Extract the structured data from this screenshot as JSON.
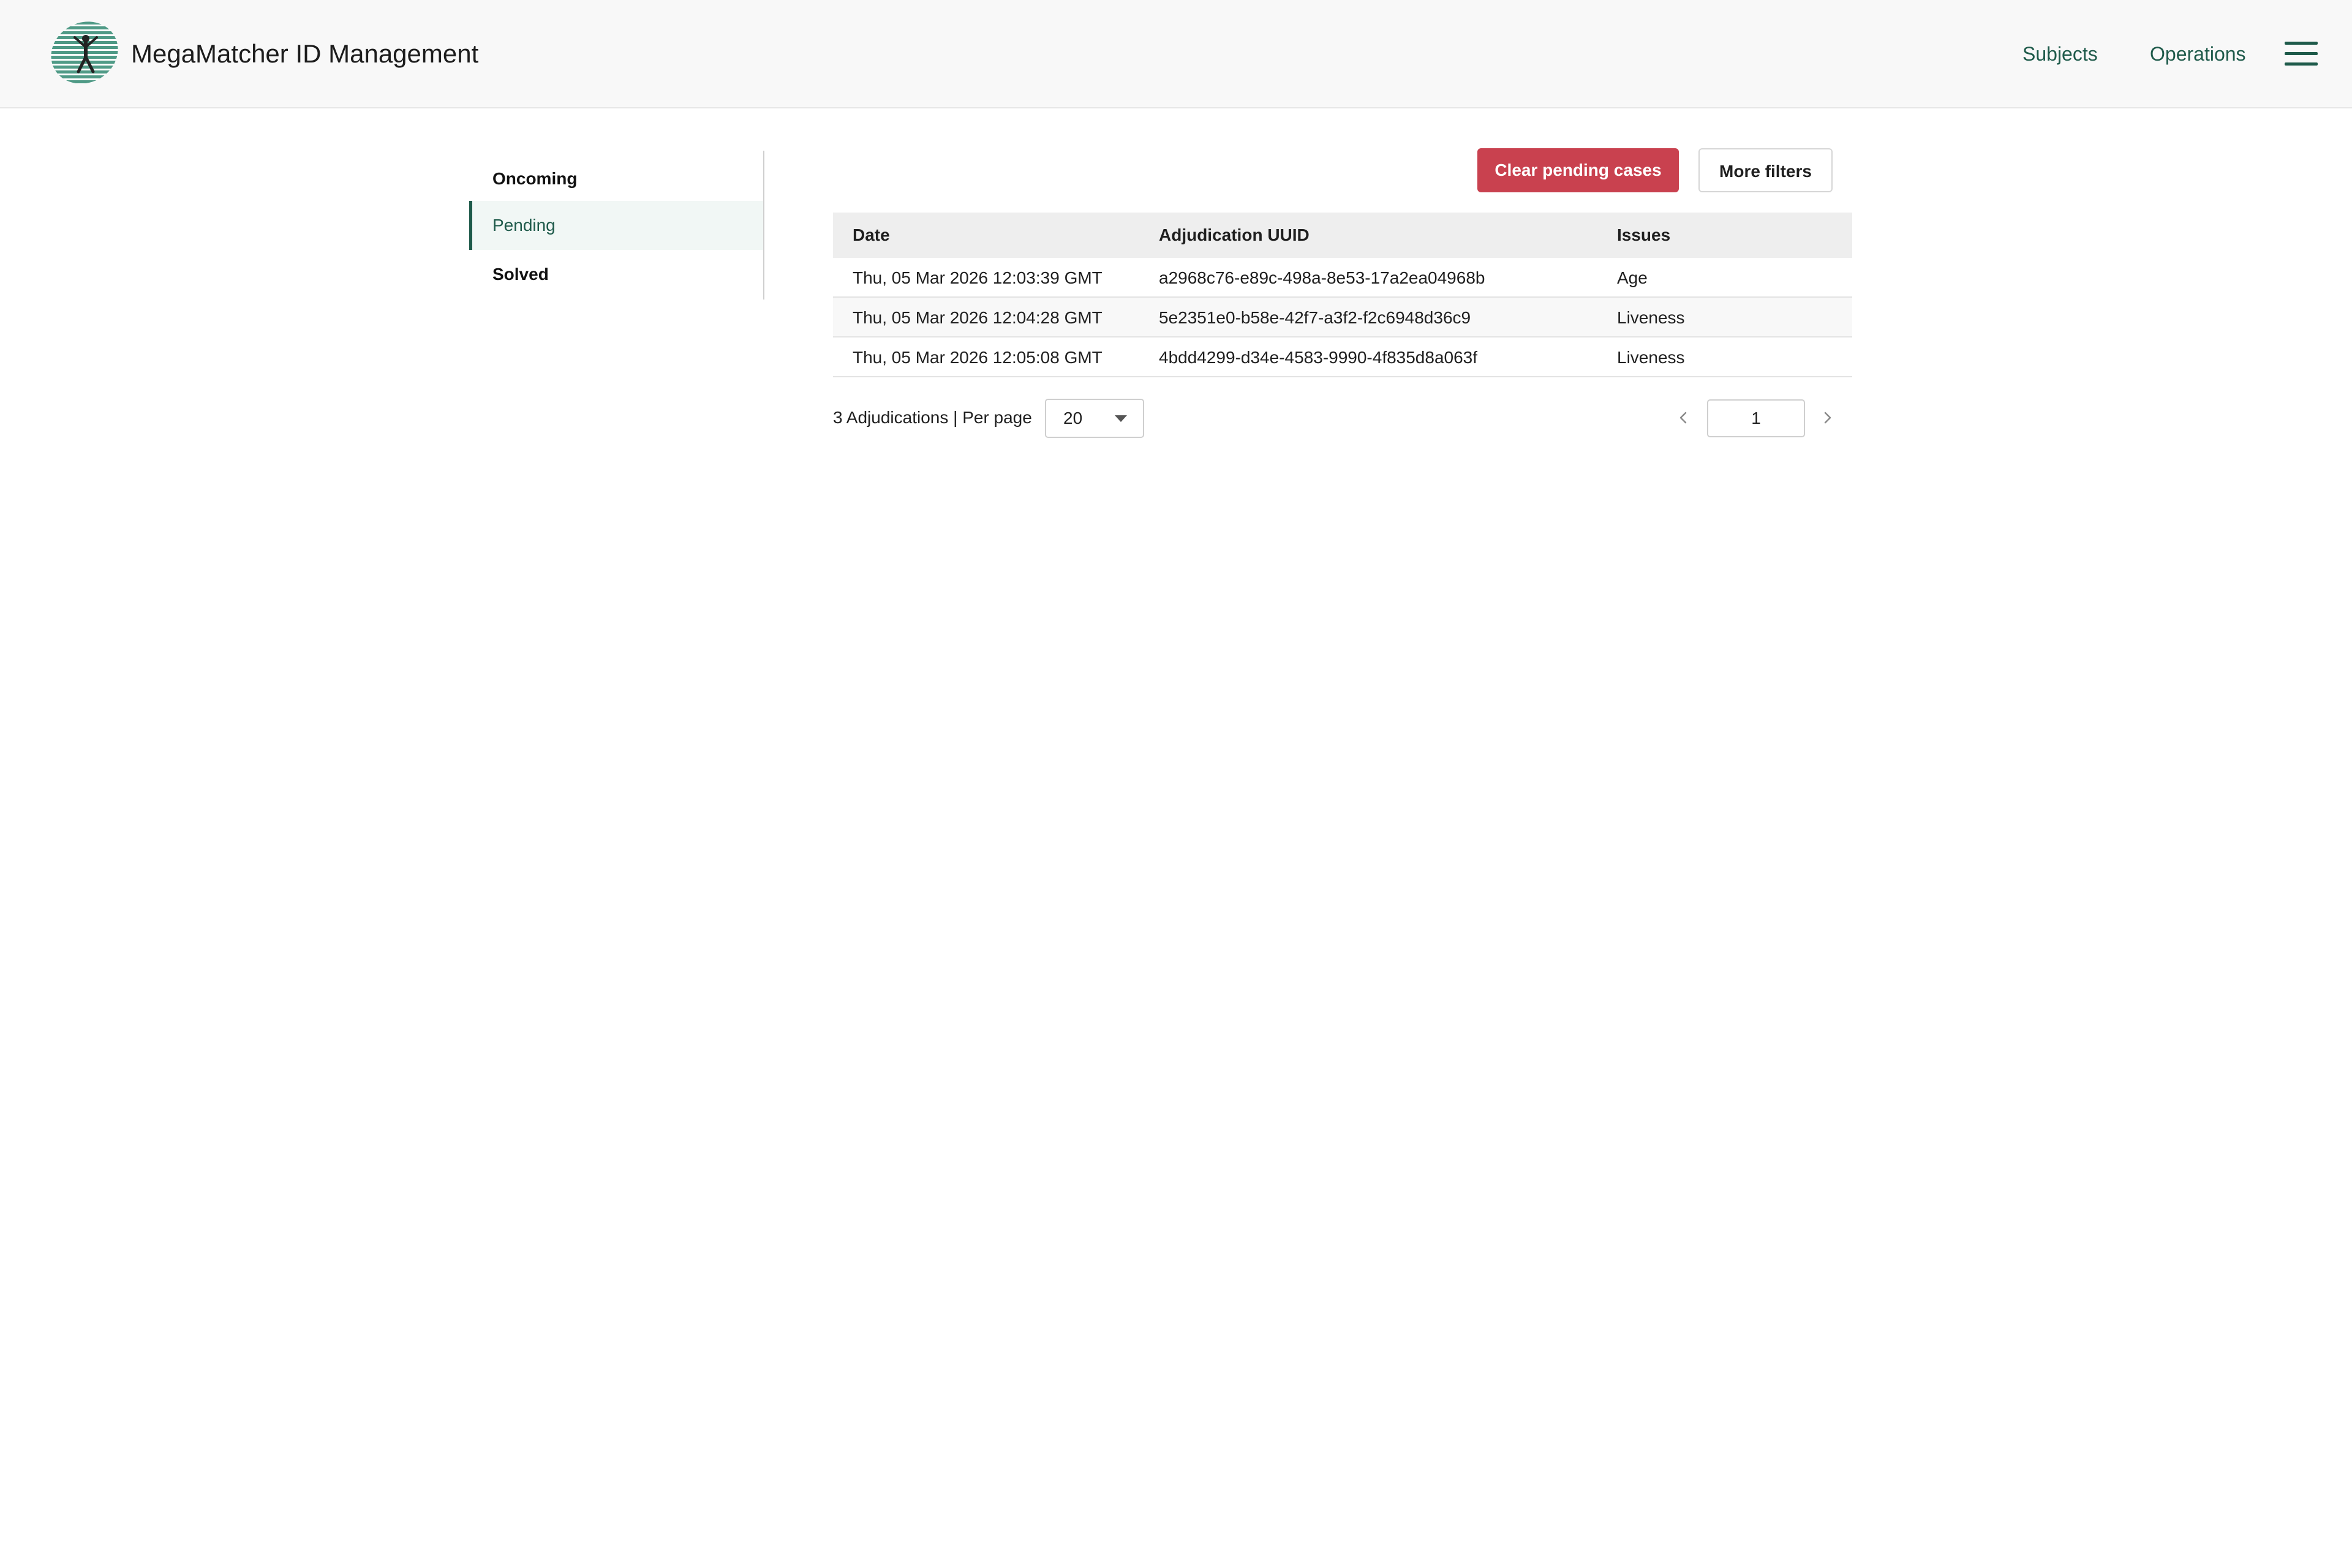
{
  "header": {
    "app_title": "MegaMatcher ID Management",
    "nav": {
      "subjects": "Subjects",
      "operations": "Operations"
    },
    "logo_icon": "megamatcher-logo-icon",
    "menu_icon": "hamburger-menu-icon"
  },
  "sidebar": {
    "items": [
      {
        "label": "Oncoming",
        "active": false
      },
      {
        "label": "Pending",
        "active": true
      },
      {
        "label": "Solved",
        "active": false
      }
    ]
  },
  "toolbar": {
    "clear_label": "Clear pending cases",
    "filters_label": "More filters"
  },
  "table": {
    "columns": [
      "Date",
      "Adjudication UUID",
      "Issues"
    ],
    "rows": [
      {
        "date": "Thu, 05 Mar 2026 12:03:39 GMT",
        "uuid": "a2968c76-e89c-498a-8e53-17a2ea04968b",
        "issues": "Age"
      },
      {
        "date": "Thu, 05 Mar 2026 12:04:28 GMT",
        "uuid": "5e2351e0-b58e-42f7-a3f2-f2c6948d36c9",
        "issues": "Liveness"
      },
      {
        "date": "Thu, 05 Mar 2026 12:05:08 GMT",
        "uuid": "4bdd4299-d34e-4583-9990-4f835d8a063f",
        "issues": "Liveness"
      }
    ]
  },
  "pagination": {
    "count_label": "3 Adjudications | Per page",
    "per_page": "20",
    "page": "1",
    "prev_icon": "chevron-left-icon",
    "next_icon": "chevron-right-icon"
  },
  "colors": {
    "accent": "#1e5a4a",
    "danger": "#c9414f",
    "header_bg": "#f8f8f8"
  }
}
